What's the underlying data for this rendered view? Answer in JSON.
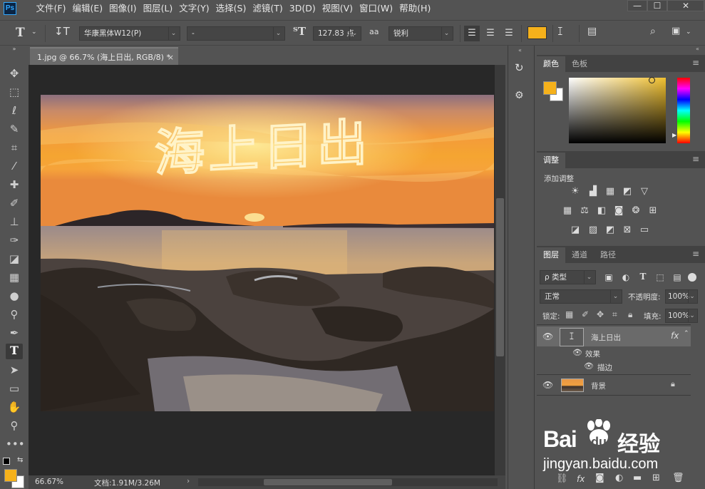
{
  "app": {
    "logo": "Ps"
  },
  "menubar": {
    "items": [
      "文件(F)",
      "编辑(E)",
      "图像(I)",
      "图层(L)",
      "文字(Y)",
      "选择(S)",
      "滤镜(T)",
      "3D(D)",
      "视图(V)",
      "窗口(W)",
      "帮助(H)"
    ],
    "window_controls": {
      "minimize": "—",
      "maximize": "☐",
      "close": "✕"
    }
  },
  "options": {
    "font_family": "华康黑体W12(P)",
    "font_style": "-",
    "font_size": "127.83 点",
    "antialias_label": "aa",
    "antialias": "锐利",
    "color_swatch": "#f5b11b"
  },
  "document": {
    "tab_title": "1.jpg @ 66.7% (海上日出, RGB/8) *",
    "overlay_text": "海上日出"
  },
  "status": {
    "zoom": "66.67%",
    "doc_info": "文档:1.91M/3.26M"
  },
  "colors": {
    "foreground": "#f5b11b",
    "background": "#ffffff"
  },
  "color_panel": {
    "tabs": [
      "颜色",
      "色板"
    ],
    "accent": "#f0c030"
  },
  "adjustments_panel": {
    "title": "调整",
    "subtitle": "添加调整"
  },
  "layers_panel": {
    "tabs": [
      "图层",
      "通道",
      "路径"
    ],
    "filter": "ρ 类型",
    "blend_mode": "正常",
    "opacity_label": "不透明度:",
    "opacity_value": "100%",
    "lock_label": "锁定:",
    "fill_label": "填充:",
    "fill_value": "100%",
    "layers": [
      {
        "name": "海上日出",
        "type": "text",
        "fx": "fx"
      },
      {
        "name": "背景",
        "type": "image",
        "locked": true
      }
    ],
    "effects_label": "效果",
    "effect_stroke": "描边"
  },
  "watermark": {
    "brand": "Bai",
    "brand2": "du",
    "text": "经验",
    "url": "jingyan.baidu.com"
  }
}
